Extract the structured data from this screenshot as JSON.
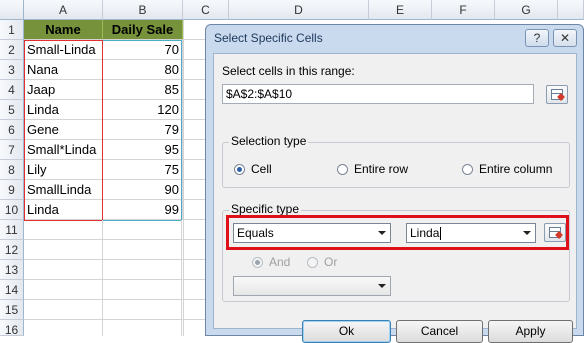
{
  "sheet": {
    "columns": [
      "A",
      "B",
      "C",
      "D",
      "E",
      "F",
      "G"
    ],
    "rows": [
      "1",
      "2",
      "3",
      "4",
      "5",
      "6",
      "7",
      "8",
      "9",
      "10",
      "11",
      "12",
      "13",
      "14",
      "15",
      "16"
    ],
    "header": {
      "name": "Name",
      "sale": "Daily Sale"
    },
    "data": [
      {
        "name": "Small-Linda",
        "sale": "70"
      },
      {
        "name": "Nana",
        "sale": "80"
      },
      {
        "name": "Jaap",
        "sale": "85"
      },
      {
        "name": "Linda",
        "sale": "120"
      },
      {
        "name": "Gene",
        "sale": "79"
      },
      {
        "name": "Small*Linda",
        "sale": "95"
      },
      {
        "name": "Lily",
        "sale": "75"
      },
      {
        "name": "SmallLinda",
        "sale": "90"
      },
      {
        "name": "Linda",
        "sale": "99"
      }
    ]
  },
  "dialog": {
    "title": "Select Specific Cells",
    "help_label": "?",
    "close_label": "✕",
    "range_label": "Select cells in this range:",
    "range_value": "$A$2:$A$10",
    "selection_type": {
      "label": "Selection type",
      "options": [
        "Cell",
        "Entire row",
        "Entire column"
      ],
      "selected": "Cell"
    },
    "specific_type": {
      "label": "Specific type",
      "operator": "Equals",
      "value": "Linda",
      "and_label": "And",
      "or_label": "Or"
    },
    "buttons": {
      "ok": "Ok",
      "cancel": "Cancel",
      "apply": "Apply"
    }
  }
}
